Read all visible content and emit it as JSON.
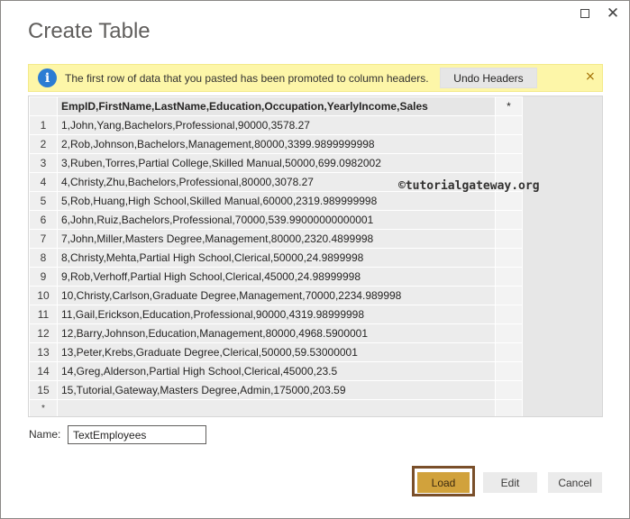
{
  "window": {
    "maximize_icon": "maximize-icon",
    "close_glyph": "✕"
  },
  "dialog": {
    "title": "Create Table"
  },
  "infobar": {
    "icon": "info-icon",
    "icon_glyph": "i",
    "message": "The first row of data that you pasted has been promoted to column headers.",
    "undo_label": "Undo Headers",
    "close_glyph": "×"
  },
  "grid": {
    "header": "EmpID,FirstName,LastName,Education,Occupation,YearlyIncome,Sales",
    "add_column_symbol": "*",
    "new_row_symbol": "*",
    "rows": [
      {
        "num": "1",
        "text": "1,John,Yang,Bachelors,Professional,90000,3578.27"
      },
      {
        "num": "2",
        "text": "2,Rob,Johnson,Bachelors,Management,80000,3399.9899999998"
      },
      {
        "num": "3",
        "text": "3,Ruben,Torres,Partial College,Skilled Manual,50000,699.0982002"
      },
      {
        "num": "4",
        "text": "4,Christy,Zhu,Bachelors,Professional,80000,3078.27"
      },
      {
        "num": "5",
        "text": "5,Rob,Huang,High School,Skilled Manual,60000,2319.989999998"
      },
      {
        "num": "6",
        "text": "6,John,Ruiz,Bachelors,Professional,70000,539.99000000000001"
      },
      {
        "num": "7",
        "text": "7,John,Miller,Masters Degree,Management,80000,2320.4899998"
      },
      {
        "num": "8",
        "text": "8,Christy,Mehta,Partial High School,Clerical,50000,24.9899998"
      },
      {
        "num": "9",
        "text": "9,Rob,Verhoff,Partial High School,Clerical,45000,24.98999998"
      },
      {
        "num": "10",
        "text": "10,Christy,Carlson,Graduate Degree,Management,70000,2234.989998"
      },
      {
        "num": "11",
        "text": "11,Gail,Erickson,Education,Professional,90000,4319.98999998"
      },
      {
        "num": "12",
        "text": "12,Barry,Johnson,Education,Management,80000,4968.5900001"
      },
      {
        "num": "13",
        "text": "13,Peter,Krebs,Graduate Degree,Clerical,50000,59.53000001"
      },
      {
        "num": "14",
        "text": "14,Greg,Alderson,Partial High School,Clerical,45000,23.5"
      },
      {
        "num": "15",
        "text": "15,Tutorial,Gateway,Masters Degree,Admin,175000,203.59"
      }
    ]
  },
  "watermark": "©tutorialgateway.org",
  "name_field": {
    "label": "Name:",
    "value": "TextEmployees"
  },
  "buttons": {
    "load": "Load",
    "edit": "Edit",
    "cancel": "Cancel"
  },
  "colors": {
    "infobar_bg": "#fdf6a8",
    "load_button": "#d1a23c",
    "load_frame": "#7a4f2a",
    "info_icon": "#2b7cd3"
  }
}
